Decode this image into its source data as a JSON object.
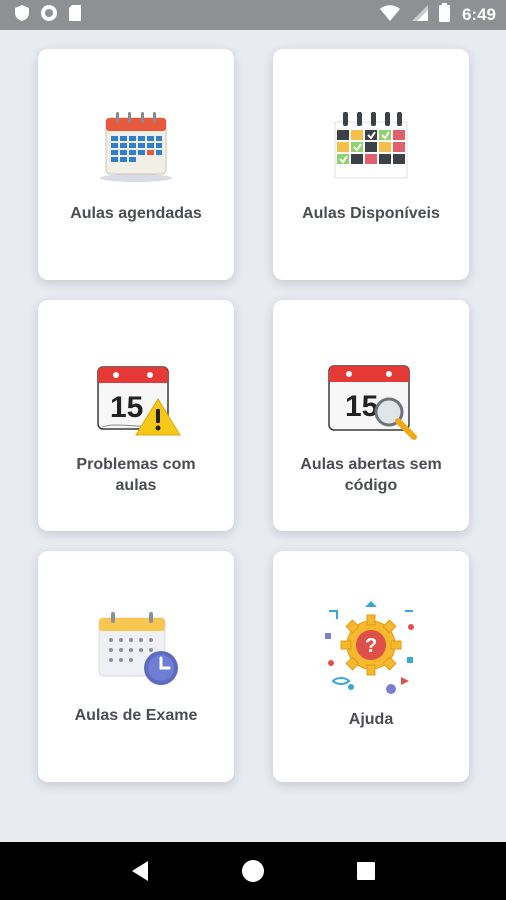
{
  "status_bar": {
    "time": "6:49",
    "left_icons": [
      "shield-icon",
      "record-icon",
      "sd-card-icon"
    ],
    "right_icons": [
      "wifi-icon",
      "cell-signal-icon",
      "battery-icon"
    ]
  },
  "grid": {
    "cards": [
      {
        "label": "Aulas agendadas",
        "icon": "calendar-grid-icon"
      },
      {
        "label": "Aulas Disponíveis",
        "icon": "schedule-checks-icon"
      },
      {
        "label": "Problemas com aulas",
        "icon": "calendar-warning-icon"
      },
      {
        "label": "Aulas abertas sem código",
        "icon": "calendar-search-icon"
      },
      {
        "label": "Aulas de Exame",
        "icon": "calendar-clock-icon"
      },
      {
        "label": "Ajuda",
        "icon": "help-gear-icon"
      }
    ]
  },
  "calendar_day_number": "15",
  "colors": {
    "calendar_red": "#e53935",
    "warning_yellow": "#f9c718",
    "clock_purple": "#5c6bc0",
    "label_text": "#4a4d52"
  },
  "nav_bar": {
    "buttons": [
      "back-icon",
      "home-icon",
      "recents-icon"
    ]
  }
}
